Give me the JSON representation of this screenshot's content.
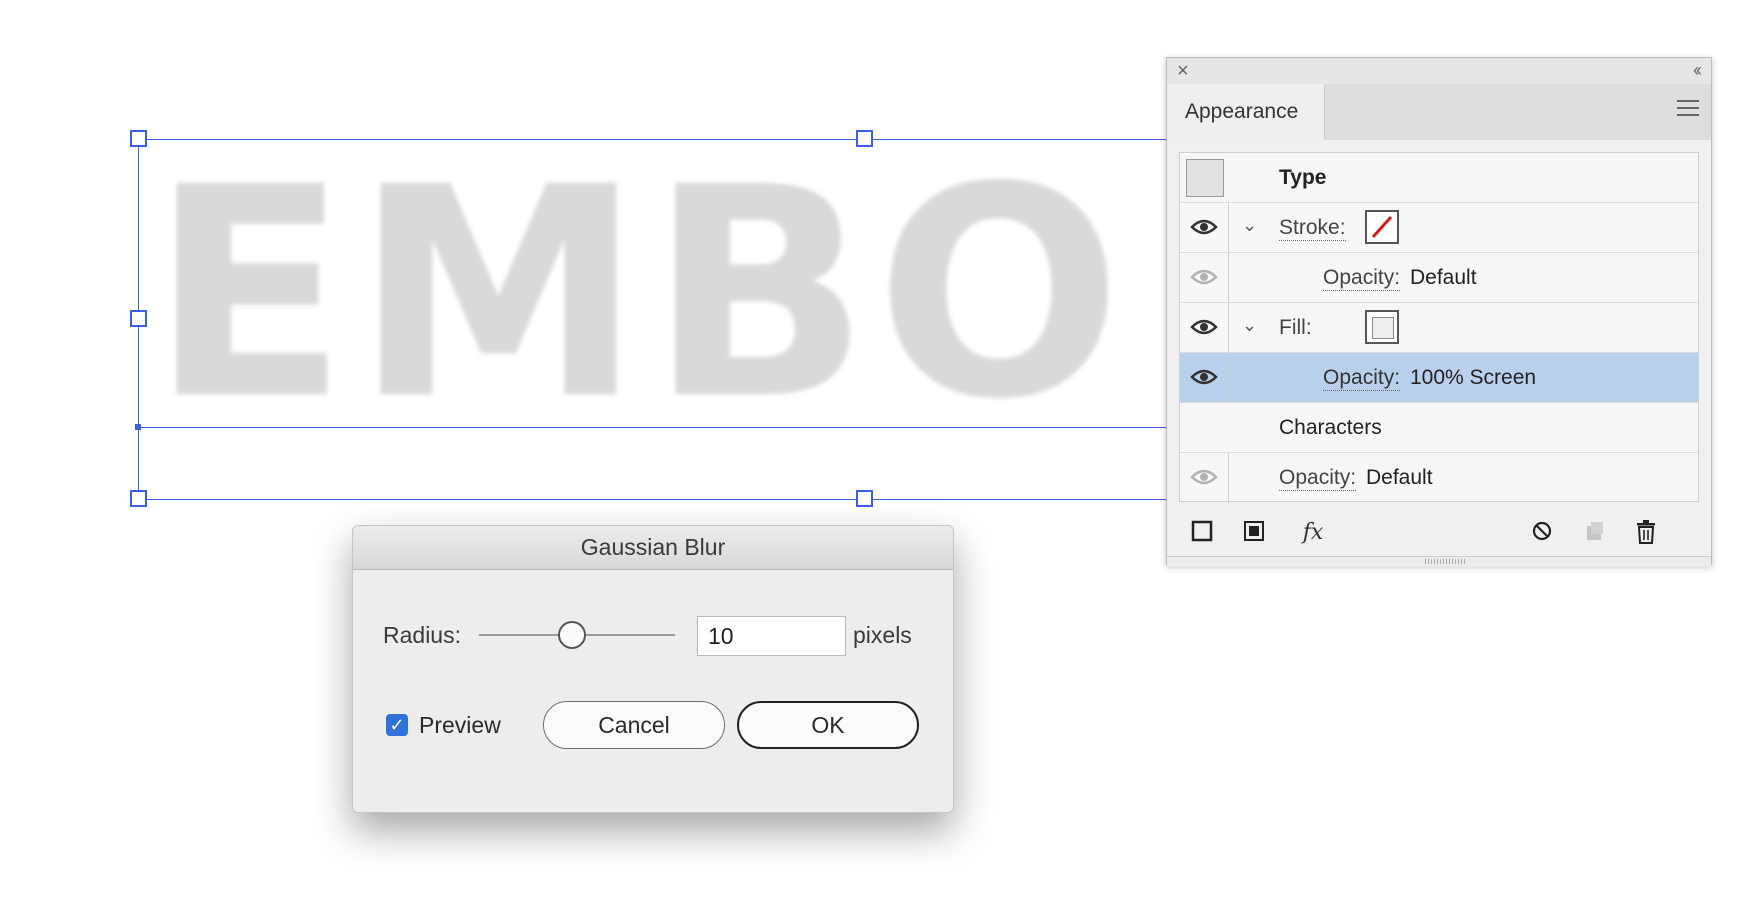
{
  "canvas": {
    "artwork_text": "EMBO",
    "accent_color": "#3a5ee8"
  },
  "appearance_panel": {
    "tab_label": "Appearance",
    "close_glyph": "×",
    "collapse_glyph": "‹‹",
    "rows": {
      "type_label": "Type",
      "stroke_label": "Stroke:",
      "stroke_opacity_label": "Opacity:",
      "stroke_opacity_value": "Default",
      "fill_label": "Fill:",
      "fill_opacity_label": "Opacity:",
      "fill_opacity_value": "100% Screen",
      "characters_label": "Characters",
      "char_opacity_label": "Opacity:",
      "char_opacity_value": "Default"
    },
    "bottom_icons": [
      "add-stroke-icon",
      "add-fill-icon",
      "fx-icon",
      "clear-appearance-icon",
      "duplicate-item-icon",
      "trash-icon"
    ],
    "fx_label": "fx",
    "selected_row_color": "#b9d0ec"
  },
  "dialog": {
    "title": "Gaussian Blur",
    "radius_label": "Radius:",
    "radius_value": "10",
    "radius_unit": "pixels",
    "preview_label": "Preview",
    "preview_checked": true,
    "cancel_label": "Cancel",
    "ok_label": "OK",
    "check_color": "#2f73d9"
  }
}
